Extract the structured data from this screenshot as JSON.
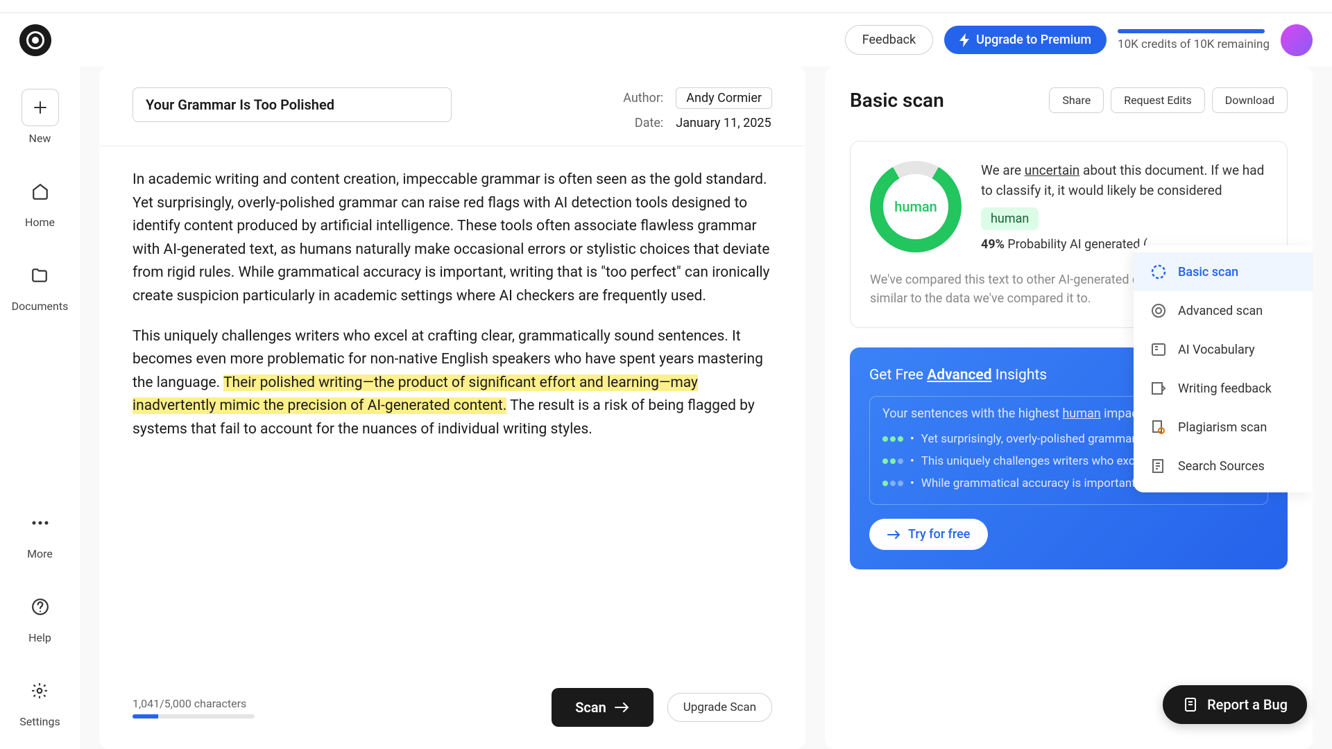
{
  "header": {
    "feedback": "Feedback",
    "upgrade": "Upgrade to Premium",
    "credits": "10K credits of 10K remaining"
  },
  "sidebar": {
    "new": "New",
    "home": "Home",
    "documents": "Documents",
    "more": "More",
    "help": "Help",
    "settings": "Settings"
  },
  "doc": {
    "title": "Your Grammar Is Too Polished",
    "author_label": "Author:",
    "author": "Andy Cormier",
    "date_label": "Date:",
    "date": "January 11, 2025",
    "p1": "In academic writing and content creation, impeccable grammar is often seen as the gold standard. Yet surprisingly, overly-polished grammar can raise red flags with AI detection tools designed to identify content produced by artificial intelligence. These tools often associate flawless grammar with AI-generated text, as humans naturally make occasional errors or stylistic choices that deviate from rigid rules. While grammatical accuracy is important, writing that is \"too perfect\" can ironically create suspicion particularly in academic settings where AI checkers are frequently used.",
    "p2a": "This uniquely challenges writers who excel at crafting clear, grammatically sound sentences. It becomes even more problematic for non-native English speakers who have spent years mastering the language. ",
    "p2hl": "Their polished writing—the product of significant effort and learning—may inadvertently mimic the precision of AI-generated content.",
    "p2b": " The result is a risk of being flagged by systems that fail to account for the nuances of individual writing styles.",
    "chars": "1,041/5,000 characters",
    "scan_btn": "Scan",
    "upgrade_scan": "Upgrade Scan"
  },
  "scan": {
    "title": "Basic scan",
    "share": "Share",
    "request_edits": "Request Edits",
    "download": "Download",
    "gauge_label": "human",
    "uncertain_pre": "We are ",
    "uncertain": "uncertain",
    "uncertain_post": " about this document. If we had to classify it, it would likely be considered",
    "badge": "human",
    "prob_pct": "49%",
    "prob_label": " Probability AI generated (",
    "compare": "We've compared this text to other AI-generated documents. It's partly similar to the data we've compared it to.",
    "insights_pre": "Get Free ",
    "insights_adv": "Advanced",
    "insights_post": " Insights",
    "impact_pre": "Your sentences with the highest ",
    "impact_hl": "human",
    "impact_post": " impact",
    "s1": "Yet surprisingly, overly-polished grammar can raise red fla...",
    "s2": "This uniquely challenges writers who excel at crafting clea...",
    "s3": "While grammatical accuracy is important, writing that is \"t...",
    "try": "Try for free"
  },
  "tools": {
    "basic": "Basic scan",
    "advanced": "Advanced scan",
    "vocab": "AI Vocabulary",
    "feedback": "Writing feedback",
    "plagiarism": "Plagiarism scan",
    "sources": "Search Sources"
  },
  "report_bug": "Report a Bug"
}
